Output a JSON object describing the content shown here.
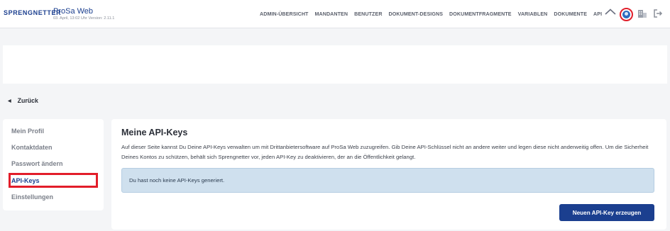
{
  "header": {
    "logo_text": "SPRENGNETTER",
    "app_title": "ProSa Web",
    "app_subtitle": "03. April, 13:02 Uhr Version: 2.11.1",
    "nav": [
      "ADMIN-ÜBERSICHT",
      "MANDANTEN",
      "BENUTZER",
      "DOKUMENT-DESIGNS",
      "DOKUMENTFRAGMENTE",
      "VARIABLEN",
      "DOKUMENTE",
      "API"
    ],
    "icons": [
      "home-icon",
      "avatar",
      "building-icon",
      "logout-icon"
    ]
  },
  "back": {
    "label": "Zurück"
  },
  "sidebar": {
    "items": [
      {
        "label": "Mein Profil",
        "active": false
      },
      {
        "label": "Kontaktdaten",
        "active": false
      },
      {
        "label": "Passwort ändern",
        "active": false
      },
      {
        "label": "API-Keys",
        "active": true
      },
      {
        "label": "Einstellungen",
        "active": false
      }
    ]
  },
  "main": {
    "title": "Meine API-Keys",
    "description": "Auf dieser Seite kannst Du Deine API-Keys verwalten um mit Drittanbietersoftware auf ProSa Web zuzugreifen. Gib Deine API-Schlüssel nicht an andere weiter und legen diese nicht anderweitig offen. Um die Sicherheit Deines Kontos zu schützen, behält sich Sprengnetter vor, jeden API-Key zu deaktivieren, der an die Öffentlichkeit gelangt.",
    "alert_text": "Du hast noch keine API-Keys generiert.",
    "button_label": "Neuen API-Key erzeugen"
  },
  "colors": {
    "brand": "#1b3f8f",
    "highlight": "#e21d2a",
    "alert_bg": "#cfe0ee",
    "page_bg": "#f4f5f7"
  }
}
